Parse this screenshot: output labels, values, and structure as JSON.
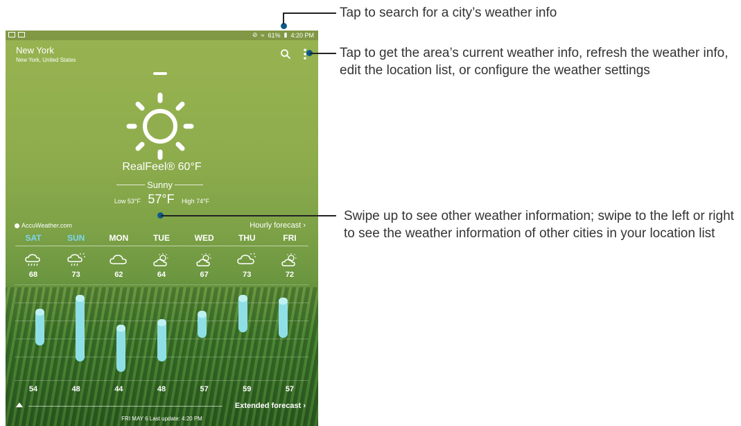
{
  "status_bar": {
    "battery": "61%",
    "time": "4:20 PM"
  },
  "location": {
    "city": "New York",
    "region": "New York, United States"
  },
  "current": {
    "realfeel": "RealFeel® 60°F",
    "condition": "Sunny",
    "low": "Low 53°F",
    "temp": "57°F",
    "high": "High 74°F"
  },
  "forecast": {
    "provider": "AccuWeather.com",
    "hourly_label": "Hourly forecast ›",
    "extended_label": "Extended forecast ›",
    "last_update": "FRI MAY 6 Last update: 4:20 PM",
    "days": [
      {
        "name": "SAT",
        "high": "68",
        "low": "54",
        "icon": "rain-cloud-icon",
        "highlight": true
      },
      {
        "name": "SUN",
        "high": "73",
        "low": "48",
        "icon": "sun-rain-cloud-icon",
        "highlight": true
      },
      {
        "name": "MON",
        "high": "62",
        "low": "44",
        "icon": "cloud-icon",
        "highlight": false
      },
      {
        "name": "TUE",
        "high": "64",
        "low": "48",
        "icon": "partly-sunny-icon",
        "highlight": false
      },
      {
        "name": "WED",
        "high": "67",
        "low": "57",
        "icon": "partly-sunny-icon",
        "highlight": false
      },
      {
        "name": "THU",
        "high": "73",
        "low": "59",
        "icon": "partly-cloudy-icon",
        "highlight": false
      },
      {
        "name": "FRI",
        "high": "72",
        "low": "57",
        "icon": "partly-sunny-icon",
        "highlight": false
      }
    ]
  },
  "callouts": {
    "search": "Tap to search for a city’s weather info",
    "menu": "Tap to get the area’s current weather info, refresh the weather info, edit the location list, or configure the weather settings",
    "swipe": "Swipe up to see other weather information; swipe to the left or right to see the weather information of other cities in your location list"
  },
  "colors": {
    "highlight_day": "#7fd6f0",
    "temp_bar": "#8fe0e6",
    "callout_dot": "#0d5a8a"
  }
}
